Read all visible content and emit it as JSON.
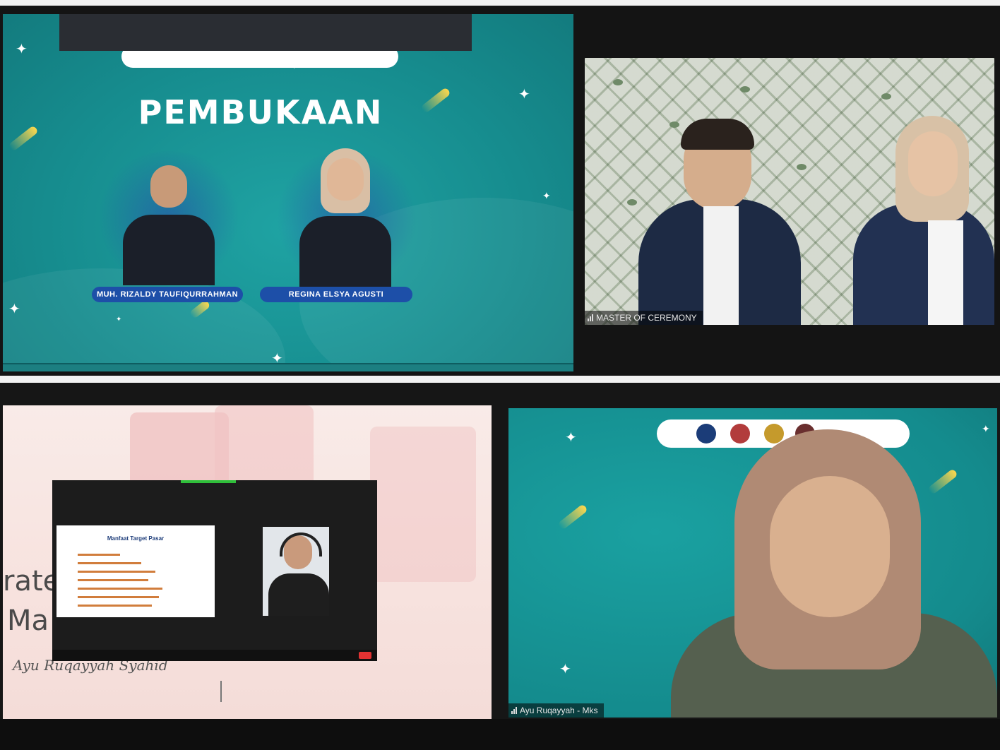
{
  "top_slide": {
    "title": "PEMBUKAAN",
    "presenters": [
      "MUH. RIZALDY TAUFIQURRAHMAN",
      "REGINA ELSYA AGUSTI"
    ]
  },
  "mc_video": {
    "name_tag": "MASTER OF CEREMONY",
    "icon": "signal-icon"
  },
  "pink_slide": {
    "text_line_1": "rate",
    "text_line_2": "Ma",
    "script_line": "Ayu Ruqayyah Syahid",
    "inner_slide_title": "Manfaat Target Pasar"
  },
  "speaker_video": {
    "name_tag": "Ayu Ruqayyah - Mks",
    "icon": "signal-icon"
  },
  "colors": {
    "teal": "#168c8e",
    "name_pill": "#1d4fa8",
    "pink": "#f7e2de"
  }
}
